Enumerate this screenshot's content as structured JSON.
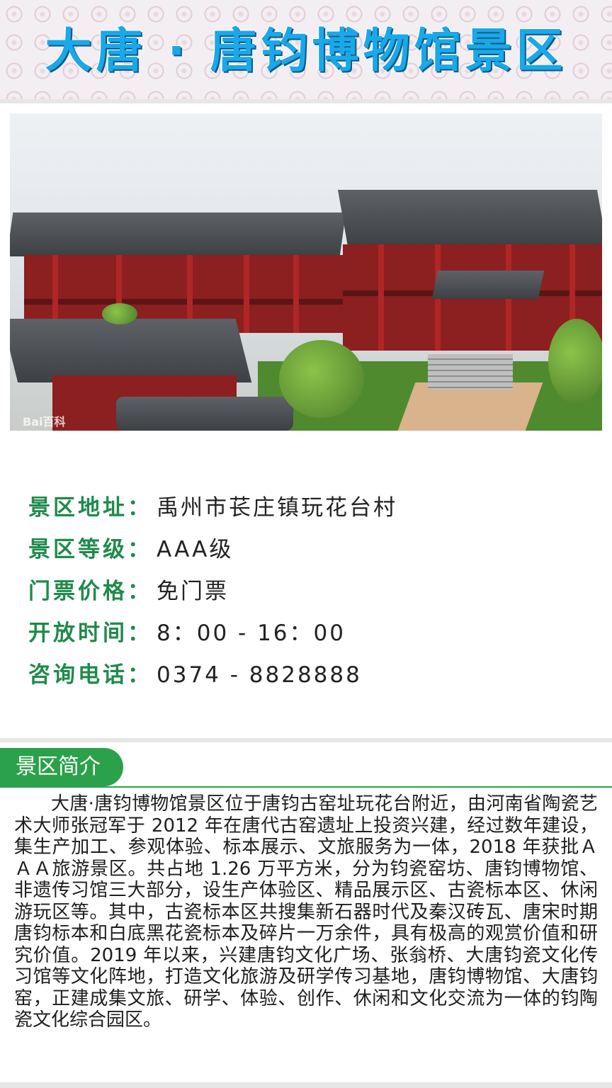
{
  "header": {
    "title": "大唐 · 唐钧博物馆景区",
    "title_color": "#1aa8e8"
  },
  "photo": {
    "watermark": "Bai百科"
  },
  "info": {
    "rows": [
      {
        "label": "景区地址",
        "sep": "：",
        "value": "禹州市苌庄镇玩花台村"
      },
      {
        "label": "景区等级",
        "sep": "：",
        "value": "AAA级"
      },
      {
        "label": "门票价格",
        "sep": "：",
        "value": "免门票"
      },
      {
        "label": "开放时间",
        "sep": "：",
        "value": "8：00 - 16：00"
      },
      {
        "label": "咨询电话",
        "sep": "：",
        "value": "0374 - 8828888"
      }
    ],
    "label_color": "#1f8a4c"
  },
  "intro": {
    "heading": "景区简介",
    "heading_bg": "#2aa14a",
    "body": "大唐·唐钧博物馆景区位于唐钧古窑址玩花台附近，由河南省陶瓷艺术大师张冠军于 2012 年在唐代古窑遗址上投资兴建，经过数年建设，集生产加工、参观体验、标本展示、文旅服务为一体，2018 年获批ＡＡＡ旅游景区。共占地 1.26 万平方米，分为钧瓷窑坊、唐钧博物馆、非遗传习馆三大部分，设生产体验区、精品展示区、古瓷标本区、休闲游玩区等。其中，古瓷标本区共搜集新石器时代及秦汉砖瓦、唐宋时期唐钧标本和白底黑花瓷标本及碎片一万余件，具有极高的观赏价值和研究价值。2019 年以来，兴建唐钧文化广场、张翁桥、大唐钧瓷文化传习馆等文化阵地，打造文化旅游及研学传习基地，唐钧博物馆、大唐钧窑，正建成集文旅、研学、体验、创作、休闲和文化交流为一体的钧陶瓷文化综合园区。"
  }
}
